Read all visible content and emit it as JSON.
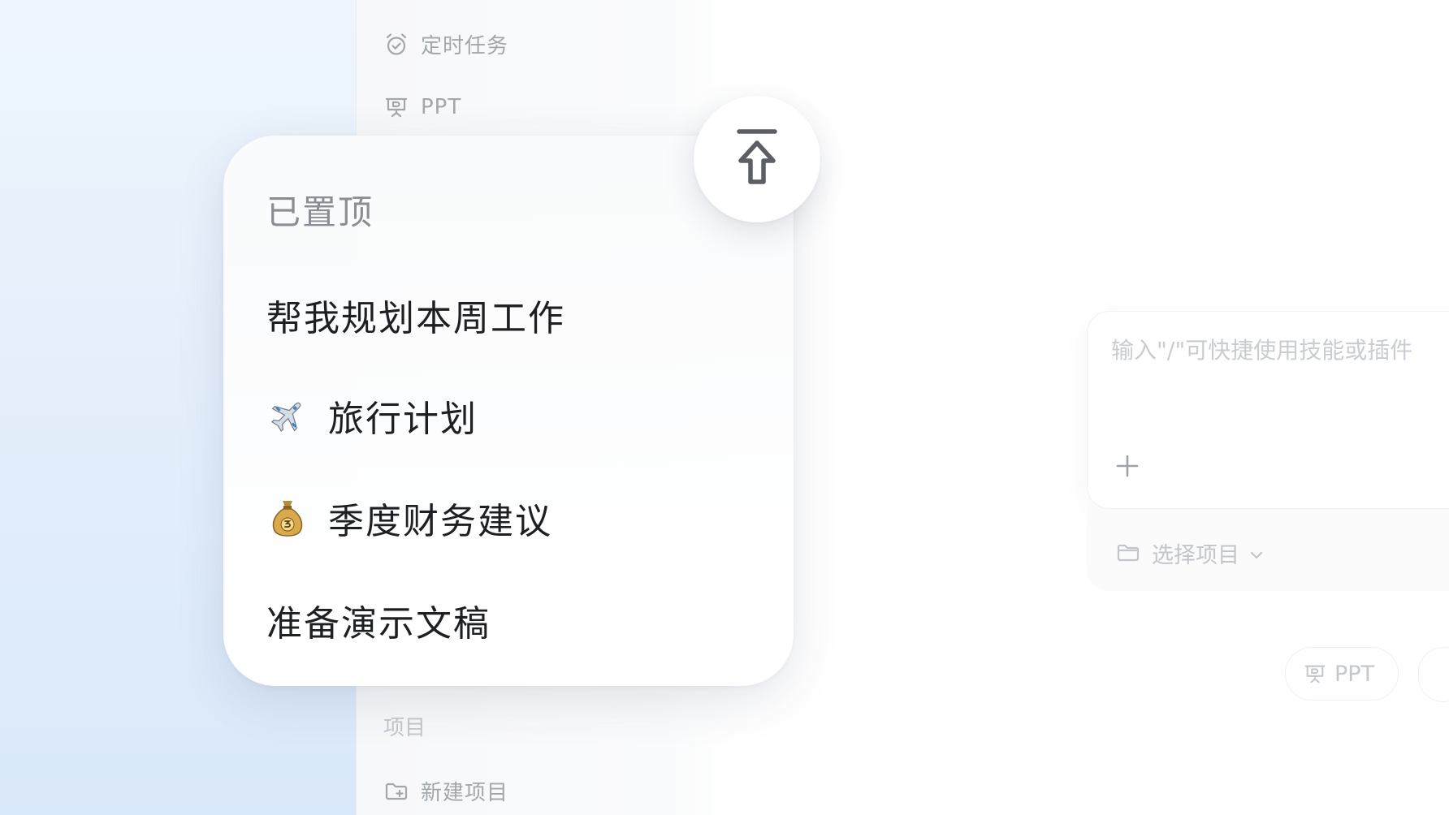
{
  "sidebar": {
    "items": [
      {
        "label": "定时任务",
        "icon": "alarm-clock-icon"
      },
      {
        "label": "PPT",
        "icon": "presentation-icon"
      }
    ],
    "section_label": "项目",
    "new_project": {
      "label": "新建项目",
      "icon": "folder-plus-icon"
    }
  },
  "pinned": {
    "title": "已置顶",
    "items": [
      {
        "label": "帮我规划本周工作",
        "emoji": ""
      },
      {
        "label": "旅行计划",
        "emoji": "airplane-icon"
      },
      {
        "label": "季度财务建议",
        "emoji": "money-bag-icon"
      },
      {
        "label": "准备演示文稿",
        "emoji": ""
      }
    ],
    "pin_button_icon": "pin-to-top-icon"
  },
  "composer": {
    "placeholder": "输入\"/\"可快捷使用技能或插件",
    "add_icon": "plus-icon",
    "select_project": {
      "label": "选择项目",
      "icon": "folder-icon"
    }
  },
  "chips": [
    {
      "label": "PPT",
      "icon": "presentation-icon"
    }
  ],
  "colors": {
    "accent_bg": "#e3eefb",
    "text_primary": "#1d1f22",
    "text_muted": "#a3a7ad"
  }
}
